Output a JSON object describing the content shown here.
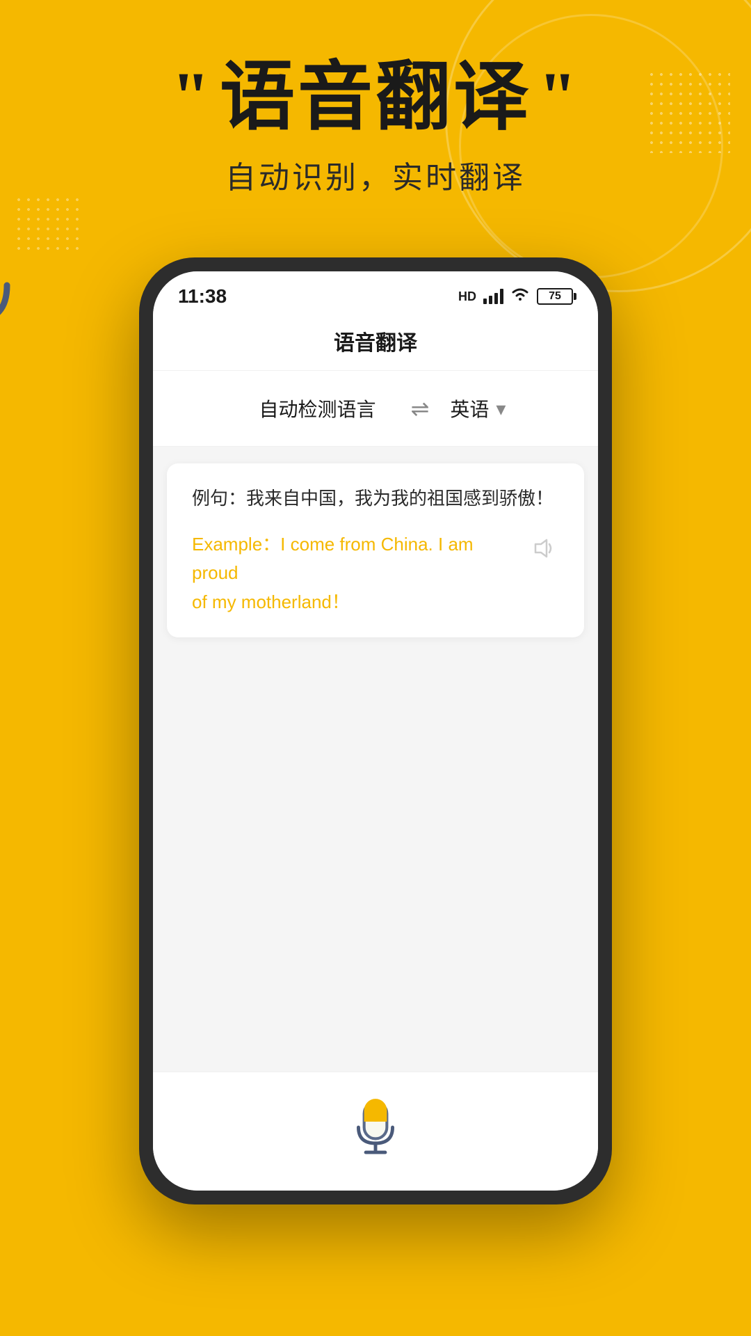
{
  "background": {
    "color": "#F5B800"
  },
  "hero": {
    "quote_open": "“",
    "quote_close": "”",
    "title": "语音翻译",
    "subtitle": "自动识别，实时翻译"
  },
  "phone": {
    "status_bar": {
      "time": "11:38",
      "hd_label": "HD",
      "battery_level": "75"
    },
    "app_header": {
      "title": "语音翻译"
    },
    "lang_selector": {
      "source_lang": "自动检测语言",
      "target_lang": "英语"
    },
    "translation": {
      "source_text": "例句：我来自中国，我为我的祖国感到骄傲！",
      "translated_line1": "Example：I come from China. I am proud",
      "translated_line2": "of my motherland！"
    }
  }
}
